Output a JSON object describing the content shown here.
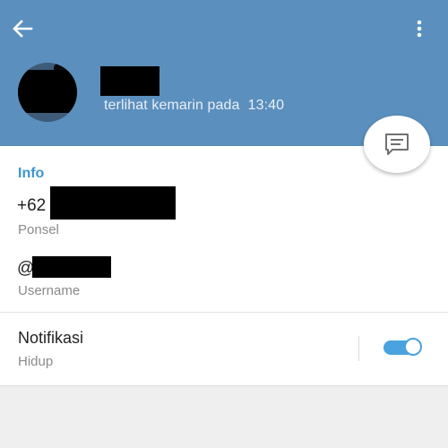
{
  "colors": {
    "header": "#5b8fbd",
    "accent": "#3d95d0",
    "toggle_on": "#4aa3df",
    "background": "#efefef"
  },
  "header": {
    "back_icon": "arrow-left-icon",
    "menu_icon": "more-vertical-icon",
    "last_seen": "terlihat kemarin pada  13:40"
  },
  "fab": {
    "icon": "message-icon"
  },
  "info": {
    "section_title": "Info",
    "phone_value": "+62",
    "phone_label": "Ponsel",
    "username_value": "@",
    "username_label": "Username"
  },
  "notifications": {
    "title": "Notifikasi",
    "status": "Hidup",
    "enabled": true
  }
}
